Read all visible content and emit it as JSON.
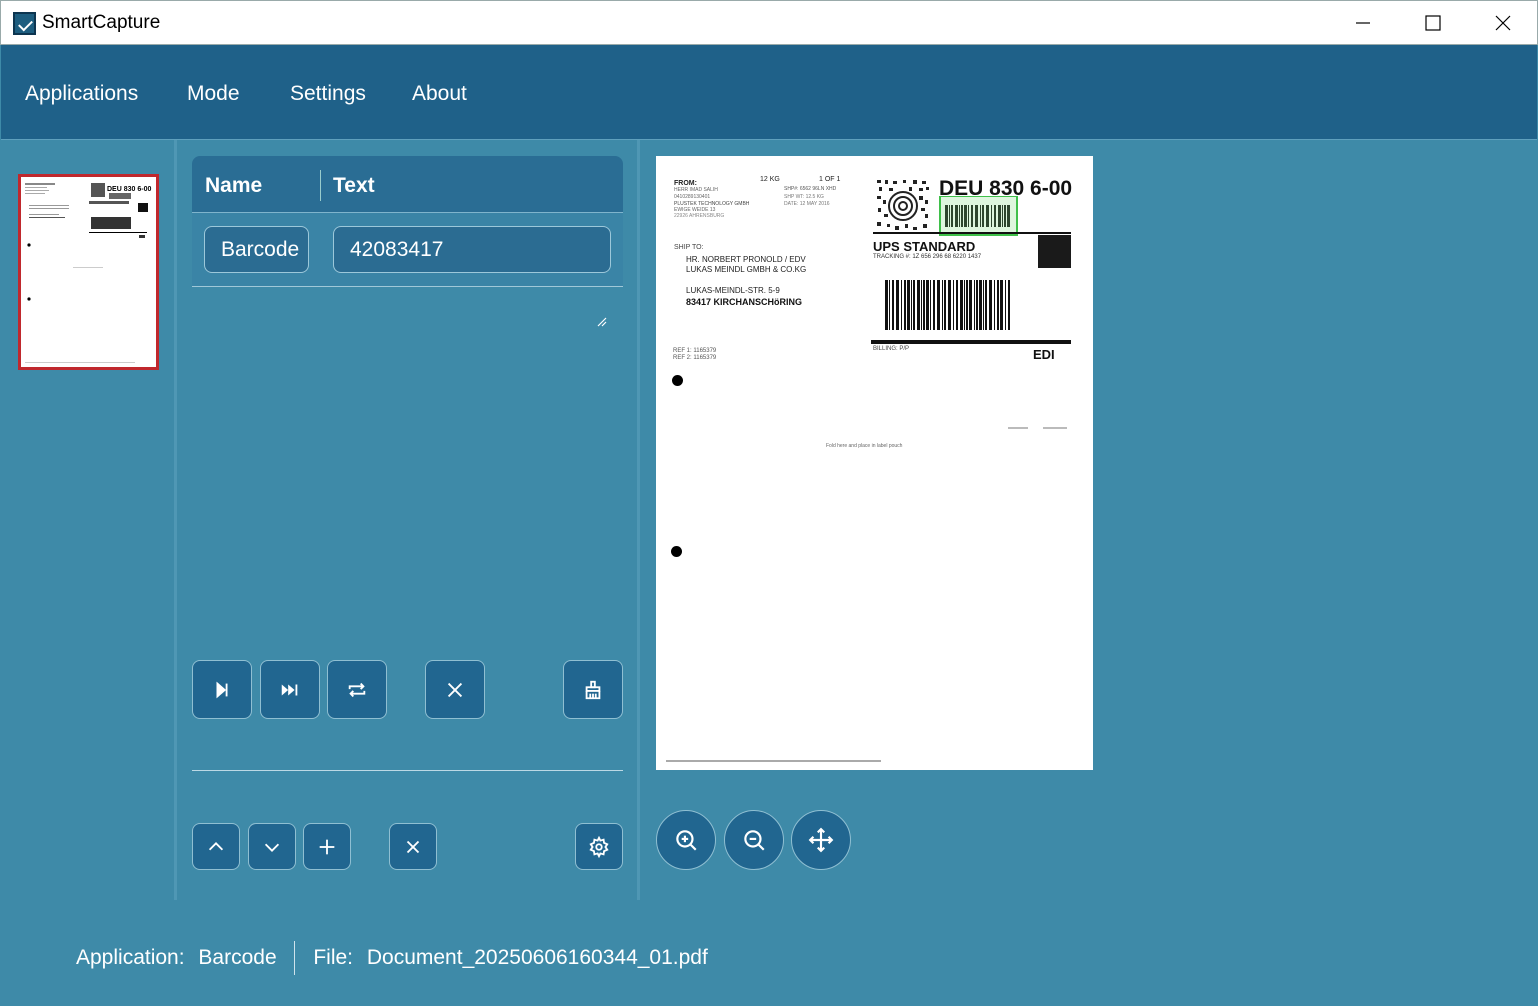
{
  "window": {
    "title": "SmartCapture"
  },
  "menu": {
    "items": [
      {
        "label": "Applications"
      },
      {
        "label": "Mode"
      },
      {
        "label": "Settings"
      },
      {
        "label": "About"
      }
    ]
  },
  "grid": {
    "columns": {
      "name": "Name",
      "text": "Text"
    },
    "row": {
      "name": "Barcode",
      "text": "42083417"
    }
  },
  "status": {
    "application_label": "Application:",
    "application_value": "Barcode",
    "file_label": "File:",
    "file_value": "Document_20250606160344_01.pdf"
  },
  "document": {
    "from": "FROM:",
    "weight": "12 KG",
    "count": "1 OF 1",
    "sender": [
      "HERR IMAD SALIH",
      "0410289130401",
      "PLUSTEK TECHNOLOGY GMBH",
      "EWIGE WEIDE 13",
      "22926 AHRENSBURG"
    ],
    "ship_info": [
      "SHP#: 6562 96LN XHD",
      "SHP WT: 12.5 KG",
      "DATE: 12 MAY 2016"
    ],
    "code": "DEU 830 6-00",
    "service": "UPS STANDARD",
    "tracking": "TRACKING #: 1Z 656 296 68 6220 1437",
    "ship_to": "SHIP TO:",
    "recipient": [
      "HR. NORBERT PRONOLD / EDV",
      "LUKAS MEINDL GMBH & CO.KG"
    ],
    "street": "LUKAS-MEINDL-STR. 5-9",
    "city": "83417  KIRCHANSCHöRING",
    "billing": "BILLING:  P/P",
    "edi": "EDI",
    "refs": [
      "REF 1: 1165379",
      "REF 2: 1165379"
    ],
    "fold": "Fold here and place in label pouch"
  },
  "colors": {
    "accent": "#1f6189",
    "background": "#3e8aa8",
    "selection": "#c0282d",
    "highlight": "#3fc04a"
  }
}
